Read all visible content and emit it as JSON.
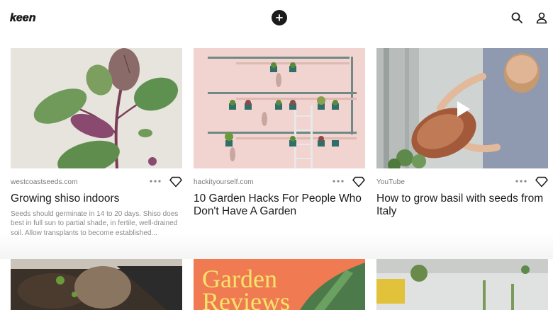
{
  "header": {
    "logo_text": "keen",
    "add_icon": "plus-icon",
    "search_icon": "search-icon",
    "profile_icon": "user-icon"
  },
  "cards": [
    {
      "source": "westcoastseeds.com",
      "title": "Growing shiso indoors",
      "description": "Seeds should germinate in 14 to 20 days. Shiso does best in full sun to partial shade, in fertile, well-drained soil. Allow transplants to become established..."
    },
    {
      "source": "hackityourself.com",
      "title": "10 Garden Hacks For People Who Don't Have A Garden"
    },
    {
      "source": "YouTube",
      "title": "How to grow basil with seeds from Italy"
    }
  ],
  "bottom_cards": [
    {
      "image": "soil-and-seedlings"
    },
    {
      "image_text_line1": "Garden",
      "image_text_line2": "Reviews"
    },
    {
      "image": "garden-pots"
    }
  ],
  "colors": {
    "brand_dark": "#1b1b1b",
    "source_gray": "#777777",
    "desc_gray": "#8a8a8a",
    "garden_reviews_bg": "#f07a52",
    "garden_reviews_text": "#f5e46a"
  }
}
